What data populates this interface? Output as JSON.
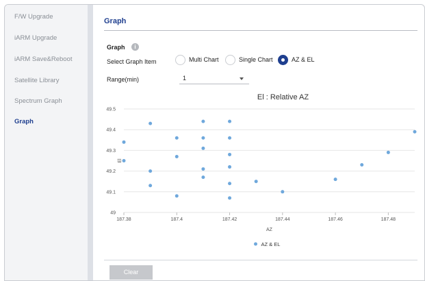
{
  "sidebar": {
    "items": [
      {
        "label": "F/W Upgrade",
        "active": false
      },
      {
        "label": "iARM Upgrade",
        "active": false
      },
      {
        "label": "iARM Save&Reboot",
        "active": false
      },
      {
        "label": "Satellite Library",
        "active": false
      },
      {
        "label": "Spectrum Graph",
        "active": false
      },
      {
        "label": "Graph",
        "active": true
      }
    ]
  },
  "main": {
    "title": "Graph",
    "section_label": "Graph",
    "info_icon": "info-icon",
    "select_graph_item_label": "Select Graph Item",
    "graph_items": [
      {
        "label": "Multi Chart",
        "checked": false
      },
      {
        "label": "Single Chart",
        "checked": false
      },
      {
        "label": "AZ & EL",
        "checked": true
      }
    ],
    "range_label": "Range(min)",
    "range_value": "1",
    "clear_button": "Clear"
  },
  "colors": {
    "accent": "#1f3f8f",
    "point": "#6fa8dc",
    "grid": "#e6e6e6"
  },
  "chart_data": {
    "type": "scatter",
    "title": "El : Relative AZ",
    "xlabel": "AZ",
    "ylabel": "El",
    "xlim": [
      187.38,
      187.49
    ],
    "ylim": [
      49,
      49.5
    ],
    "x_ticks": [
      "187.38",
      "187.4",
      "187.42",
      "187.44",
      "187.46",
      "187.48"
    ],
    "y_ticks": [
      "49",
      "49.1",
      "49.2",
      "49.3",
      "49.4",
      "49.5"
    ],
    "grid": true,
    "legend_position": "bottom",
    "series": [
      {
        "name": "AZ & EL",
        "points": [
          [
            187.38,
            49.34
          ],
          [
            187.38,
            49.25
          ],
          [
            187.39,
            49.43
          ],
          [
            187.39,
            49.2
          ],
          [
            187.39,
            49.13
          ],
          [
            187.4,
            49.36
          ],
          [
            187.4,
            49.27
          ],
          [
            187.4,
            49.08
          ],
          [
            187.41,
            49.44
          ],
          [
            187.41,
            49.36
          ],
          [
            187.41,
            49.31
          ],
          [
            187.41,
            49.21
          ],
          [
            187.41,
            49.17
          ],
          [
            187.42,
            49.44
          ],
          [
            187.42,
            49.36
          ],
          [
            187.42,
            49.28
          ],
          [
            187.42,
            49.22
          ],
          [
            187.42,
            49.14
          ],
          [
            187.42,
            49.07
          ],
          [
            187.43,
            49.15
          ],
          [
            187.44,
            49.1
          ],
          [
            187.46,
            49.16
          ],
          [
            187.47,
            49.23
          ],
          [
            187.48,
            49.29
          ],
          [
            187.49,
            49.39
          ]
        ]
      }
    ]
  }
}
